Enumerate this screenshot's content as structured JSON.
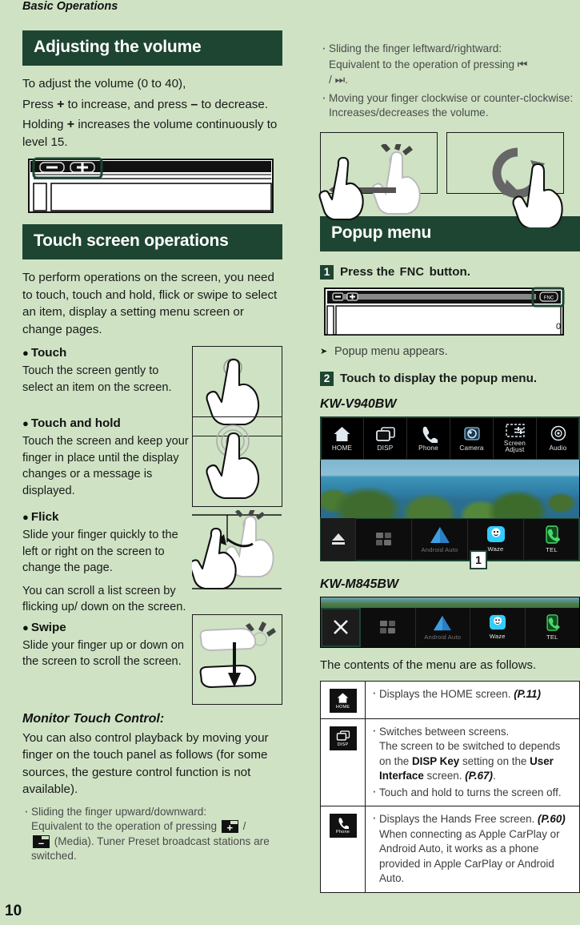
{
  "running_head": "Basic Operations",
  "page_number": "10",
  "left": {
    "volume_section": {
      "title": "Adjusting the volume",
      "line1": "To adjust the volume (0 to 40),",
      "line2_a": "Press",
      "line2_plus": "+",
      "line2_b": "to increase, and press",
      "line2_minus": "–",
      "line2_c": "to decrease.",
      "line3_a": "Holding",
      "line3_plus": "+",
      "line3_b": "increases the volume continuously to level 15."
    },
    "touch_section": {
      "title": "Touch screen operations",
      "intro": "To perform operations on the screen, you need to touch, touch and hold, flick or swipe to select an item, display a setting menu screen or change pages.",
      "gestures": [
        {
          "name": "Touch",
          "desc": "Touch the screen gently to select an item on the screen.",
          "icon": "finger-tap-icon"
        },
        {
          "name": "Touch and hold",
          "desc": "Touch the screen and keep your finger in place until the display changes or a message is displayed.",
          "icon": "finger-press-hold-icon"
        },
        {
          "name": "Flick",
          "desc": "Slide your finger quickly to the left or right on the screen to change the page.",
          "desc2": "You can scroll a list screen by flicking up/ down on the screen.",
          "icon": "finger-flick-icon"
        },
        {
          "name": "Swipe",
          "desc": "Slide your finger up or down on the screen to scroll the screen.",
          "icon": "finger-swipe-icon"
        }
      ]
    },
    "monitor_touch": {
      "title": "Monitor Touch Control:",
      "intro": "You can also control playback by moving your finger on the touch panel as follows (for some sources, the gesture control function is not available).",
      "bullet_a": "Sliding the finger upward/downward:",
      "bullet_b": "Equivalent to the operation of pressing",
      "bullet_c": "/",
      "bullet_d": "(Media). Tuner Preset broadcast stations are switched.",
      "icon_plus": "+",
      "icon_minus": "–"
    }
  },
  "right": {
    "gesture_notes": [
      {
        "a": "Sliding the finger leftward/rightward:",
        "b": "Equivalent to the operation of pressing",
        "prev": "⏮",
        "sep": "/",
        "next": "⏭",
        "end": "."
      },
      {
        "a": "Moving your finger clockwise or counter-clockwise: Increases/decreases the volume."
      }
    ],
    "gesture_boxes": [
      {
        "name": "drag-left-icon"
      },
      {
        "name": "rotate-clockwise-icon"
      }
    ],
    "popup_section": {
      "title": "Popup menu",
      "step1_num": "1",
      "step1_a": "Press the",
      "step1_key": "FNC",
      "step1_b": "button.",
      "result": "Popup menu appears.",
      "step2_num": "2",
      "step2_text": "Touch to display the popup menu.",
      "model_1": "KW-V940BW",
      "model_2": "KW-M845BW",
      "callout_1": "1",
      "table_intro": "The contents of the menu are as follows."
    },
    "device_top_keys": [
      {
        "label": "HOME",
        "icon": "home-icon"
      },
      {
        "label": "DISP",
        "icon": "display-switch-icon"
      },
      {
        "label": "Phone",
        "icon": "phone-handset-icon"
      },
      {
        "label": "Camera",
        "icon": "camera-icon"
      },
      {
        "label": "Screen Adjust",
        "label_l1": "Screen",
        "label_l2": "Adjust",
        "icon": "screen-adjust-icon"
      },
      {
        "label": "Audio",
        "icon": "audio-disc-icon"
      }
    ],
    "device_bottom_keys": [
      {
        "label": "",
        "icon": "eject-icon"
      },
      {
        "label": "",
        "icon": "apps-grid-icon"
      },
      {
        "label": "Android Auto",
        "icon": "android-auto-icon"
      },
      {
        "label": "Waze",
        "icon": "waze-icon"
      },
      {
        "label": "TEL",
        "icon": "tel-icon"
      }
    ],
    "device2_keys": [
      {
        "label": "",
        "icon": "close-x-icon"
      },
      {
        "label": "",
        "icon": "apps-grid-icon"
      },
      {
        "label": "Android Auto",
        "icon": "android-auto-icon"
      },
      {
        "label": "Waze",
        "icon": "waze-icon"
      },
      {
        "label": "TEL",
        "icon": "tel-icon"
      }
    ],
    "menu_table": [
      {
        "icon": "home-icon",
        "icon_label": "HOME",
        "lines": [
          {
            "parts": [
              {
                "t": "Displays the HOME screen. ",
                "s": "n"
              },
              {
                "t": "(P.11)",
                "s": "bi"
              }
            ]
          }
        ]
      },
      {
        "icon": "display-switch-icon",
        "icon_label": "DISP",
        "lines": [
          {
            "parts": [
              {
                "t": "Switches between screens.",
                "s": "n"
              },
              {
                "t": "BR",
                "s": "br"
              },
              {
                "t": "The screen to be switched to depends on the ",
                "s": "n"
              },
              {
                "t": "DISP Key",
                "s": "b"
              },
              {
                "t": " setting on the ",
                "s": "n"
              },
              {
                "t": "User Interface",
                "s": "b"
              },
              {
                "t": " screen. ",
                "s": "n"
              },
              {
                "t": "(P.67)",
                "s": "bi"
              },
              {
                "t": ".",
                "s": "n"
              }
            ]
          },
          {
            "parts": [
              {
                "t": "Touch and hold to turns the screen off.",
                "s": "n"
              }
            ]
          }
        ]
      },
      {
        "icon": "phone-handset-icon",
        "icon_label": "Phone",
        "lines": [
          {
            "parts": [
              {
                "t": "Displays the Hands Free screen. ",
                "s": "n"
              },
              {
                "t": "(P.60)",
                "s": "bi"
              },
              {
                "t": "BR",
                "s": "br"
              },
              {
                "t": "When connecting as Apple CarPlay or Android Auto, it works as a phone provided in Apple CarPlay or Android Auto.",
                "s": "n"
              }
            ]
          }
        ]
      }
    ]
  },
  "colors": {
    "page_bg": "#cfe3c4",
    "banner_bg": "#1e4532",
    "banner_text": "#ffffff",
    "body_text": "#1a1a1a",
    "muted_text": "#4a4a4a",
    "device_bg": "#000000"
  }
}
